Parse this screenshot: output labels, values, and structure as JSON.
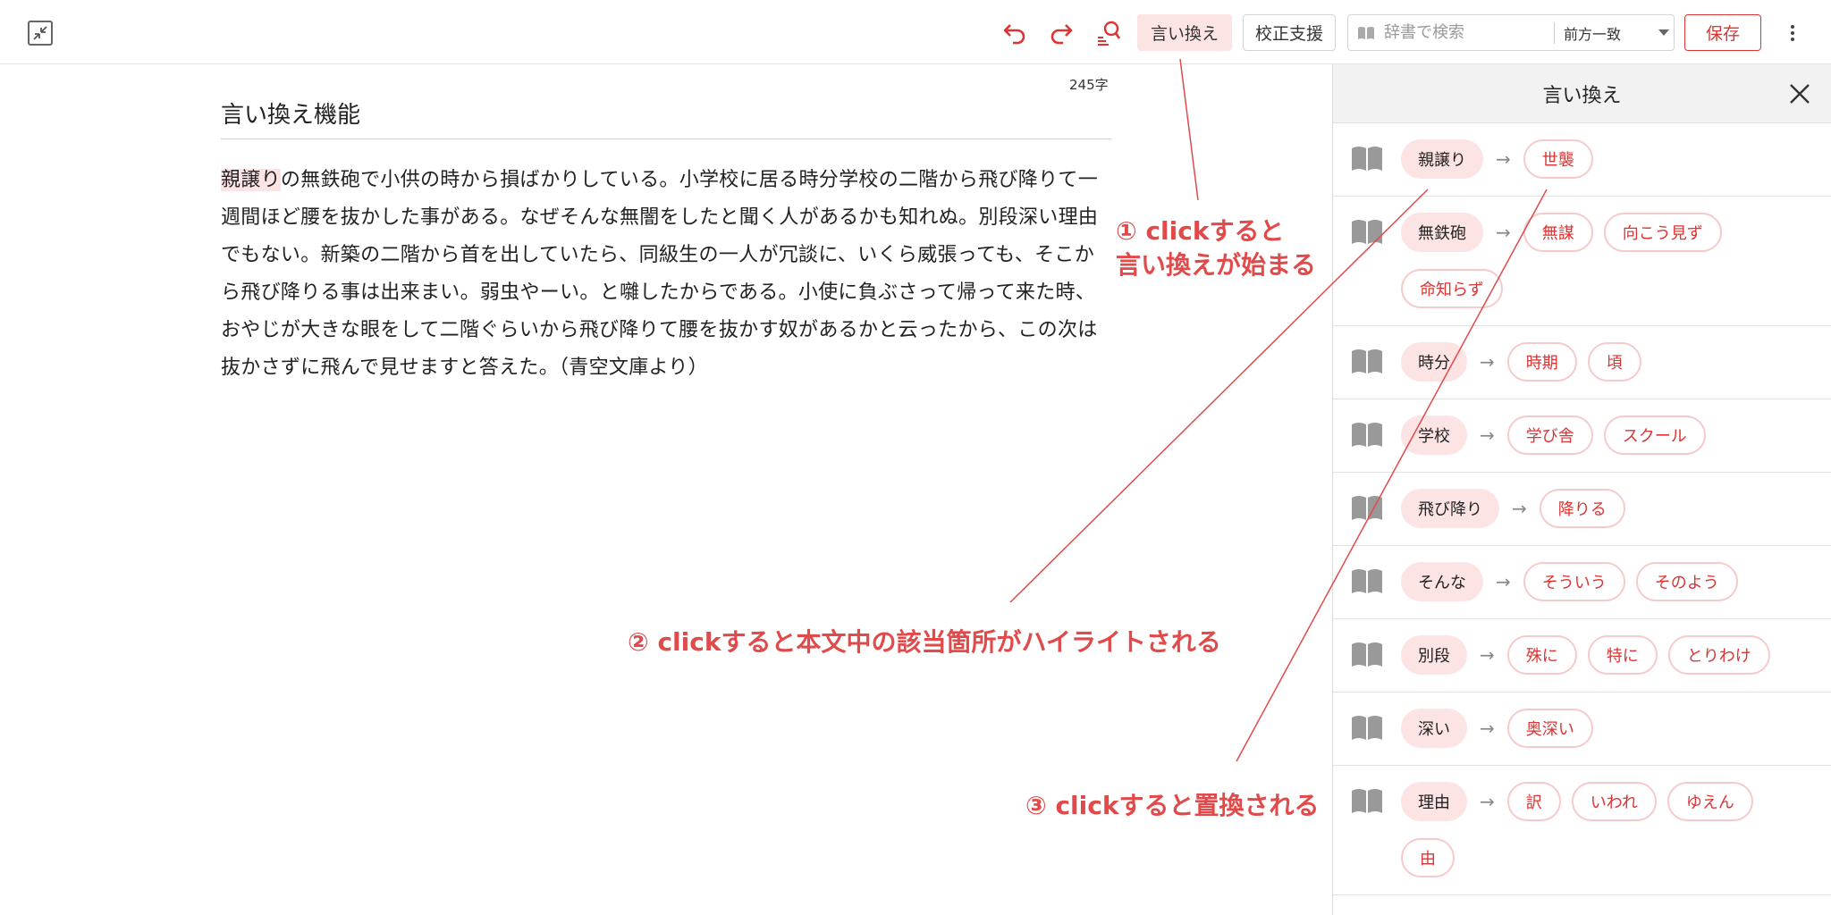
{
  "toolbar": {
    "paraphrase_label": "言い換え",
    "proofread_label": "校正支援",
    "search_placeholder": "辞書で検索",
    "search_mode": "前方一致",
    "save_label": "保存"
  },
  "editor": {
    "char_count": "245字",
    "title": "言い換え機能",
    "highlighted": "親譲り",
    "body_rest": "の無鉄砲で小供の時から損ばかりしている。小学校に居る時分学校の二階から飛び降りて一週間ほど腰を抜かした事がある。なぜそんな無闇をしたと聞く人があるかも知れぬ。別段深い理由でもない。新築の二階から首を出していたら、同級生の一人が冗談に、いくら威張っても、そこから飛び降りる事は出来まい。弱虫やーい。と囃したからである。小使に負ぶさって帰って来た時、おやじが大きな眼をして二階ぐらいから飛び降りて腰を抜かす奴があるかと云ったから、この次は抜かさずに飛んで見せますと答えた。（青空文庫より）"
  },
  "panel": {
    "title": "言い換え",
    "arrow": "→",
    "rows": [
      {
        "word": "親譲り",
        "alternatives": [
          "世襲"
        ]
      },
      {
        "word": "無鉄砲",
        "alternatives": [
          "無謀",
          "向こう見ず",
          "命知らず"
        ]
      },
      {
        "word": "時分",
        "alternatives": [
          "時期",
          "頃"
        ]
      },
      {
        "word": "学校",
        "alternatives": [
          "学び舎",
          "スクール"
        ]
      },
      {
        "word": "飛び降り",
        "alternatives": [
          "降りる"
        ]
      },
      {
        "word": "そんな",
        "alternatives": [
          "そういう",
          "そのよう"
        ]
      },
      {
        "word": "別段",
        "alternatives": [
          "殊に",
          "特に",
          "とりわけ"
        ]
      },
      {
        "word": "深い",
        "alternatives": [
          "奥深い"
        ]
      },
      {
        "word": "理由",
        "alternatives": [
          "訳",
          "いわれ",
          "ゆえん",
          "由"
        ]
      }
    ]
  },
  "annotations": {
    "a1_line1": "① clickすると",
    "a1_line2": "言い換えが始まる",
    "a2": "② clickすると本文中の該当箇所がハイライトされる",
    "a3": "③ clickすると置換される"
  },
  "colors": {
    "accent": "#d33333",
    "highlight": "#fde4e4",
    "annotation": "#e14a4a"
  }
}
